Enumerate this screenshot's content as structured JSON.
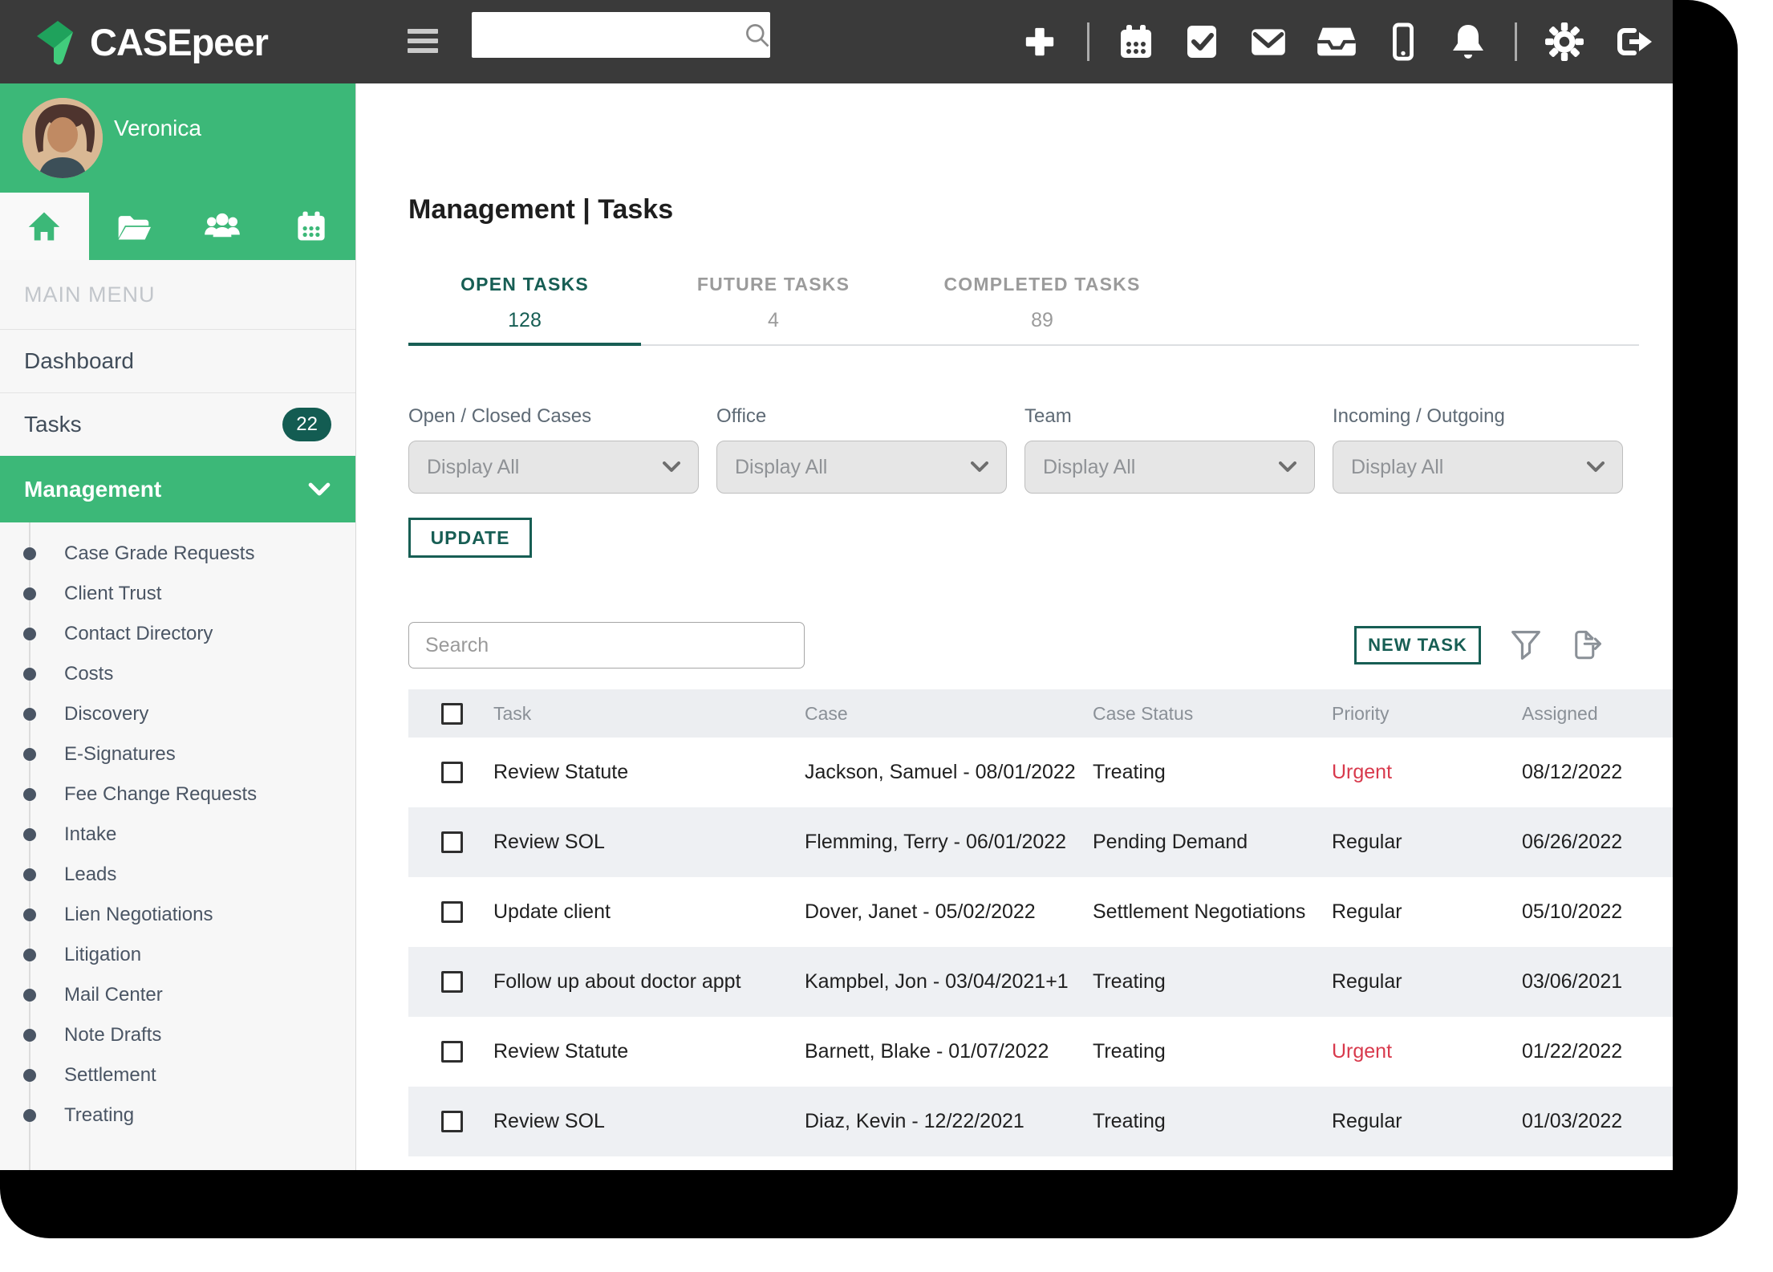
{
  "colors": {
    "brand_green": "#3CB878",
    "accent_teal": "#175E54",
    "urgent_red": "#D8394C",
    "topbar_bg": "#3A3A3A"
  },
  "topbar": {
    "logo_text": "CASEpeer",
    "search_value": "",
    "icons": [
      "add",
      "calendar",
      "tasks-check",
      "mail",
      "inbox",
      "phone",
      "notifications",
      "settings",
      "sign-out"
    ]
  },
  "sidebar": {
    "user_name": "Veronica",
    "tab_icons": [
      "home",
      "cases-folder",
      "contacts-people",
      "calendar"
    ],
    "section_label": "MAIN MENU",
    "menu": [
      {
        "label": "Dashboard"
      },
      {
        "label": "Tasks",
        "badge": "22"
      },
      {
        "label": "Management",
        "active": true
      }
    ],
    "submenu": [
      {
        "label": "Case Grade Requests"
      },
      {
        "label": "Client Trust"
      },
      {
        "label": "Contact Directory"
      },
      {
        "label": "Costs"
      },
      {
        "label": "Discovery"
      },
      {
        "label": "E-Signatures"
      },
      {
        "label": "Fee Change Requests"
      },
      {
        "label": "Intake"
      },
      {
        "label": "Leads"
      },
      {
        "label": "Lien Negotiations"
      },
      {
        "label": "Litigation"
      },
      {
        "label": "Mail Center"
      },
      {
        "label": "Note Drafts"
      },
      {
        "label": "Settlement"
      },
      {
        "label": "Treating"
      }
    ]
  },
  "main": {
    "title": "Management | Tasks",
    "tabs": [
      {
        "label": "OPEN TASKS",
        "count": "128",
        "active": true
      },
      {
        "label": "FUTURE TASKS",
        "count": "4"
      },
      {
        "label": "COMPLETED TASKS",
        "count": "89"
      }
    ],
    "filters": [
      {
        "label": "Open / Closed Cases",
        "value": "Display All"
      },
      {
        "label": "Office",
        "value": "Display All"
      },
      {
        "label": "Team",
        "value": "Display All"
      },
      {
        "label": "Incoming / Outgoing",
        "value": "Display All"
      }
    ],
    "update_label": "UPDATE",
    "search_placeholder": "Search",
    "new_task_label": "NEW TASK",
    "table": {
      "headers": {
        "task": "Task",
        "case": "Case",
        "status": "Case Status",
        "priority": "Priority",
        "assigned": "Assigned"
      },
      "rows": [
        {
          "task": "Review Statute",
          "case": "Jackson, Samuel - 08/01/2022",
          "status": "Treating",
          "priority": "Urgent",
          "urgent": true,
          "assigned": "08/12/2022"
        },
        {
          "task": "Review SOL",
          "case": "Flemming, Terry - 06/01/2022",
          "status": "Pending Demand",
          "priority": "Regular",
          "assigned": "06/26/2022"
        },
        {
          "task": "Update client",
          "case": "Dover, Janet - 05/02/2022",
          "status": "Settlement Negotiations",
          "priority": "Regular",
          "assigned": "05/10/2022"
        },
        {
          "task": "Follow up about doctor appt",
          "case": "Kampbel, Jon - 03/04/2021+1",
          "status": "Treating",
          "priority": "Regular",
          "assigned": "03/06/2021"
        },
        {
          "task": "Review Statute",
          "case": "Barnett, Blake - 01/07/2022",
          "status": "Treating",
          "priority": "Urgent",
          "urgent": true,
          "assigned": "01/22/2022"
        },
        {
          "task": "Review SOL",
          "case": "Diaz, Kevin - 12/22/2021",
          "status": "Treating",
          "priority": "Regular",
          "assigned": "01/03/2022"
        }
      ]
    }
  }
}
